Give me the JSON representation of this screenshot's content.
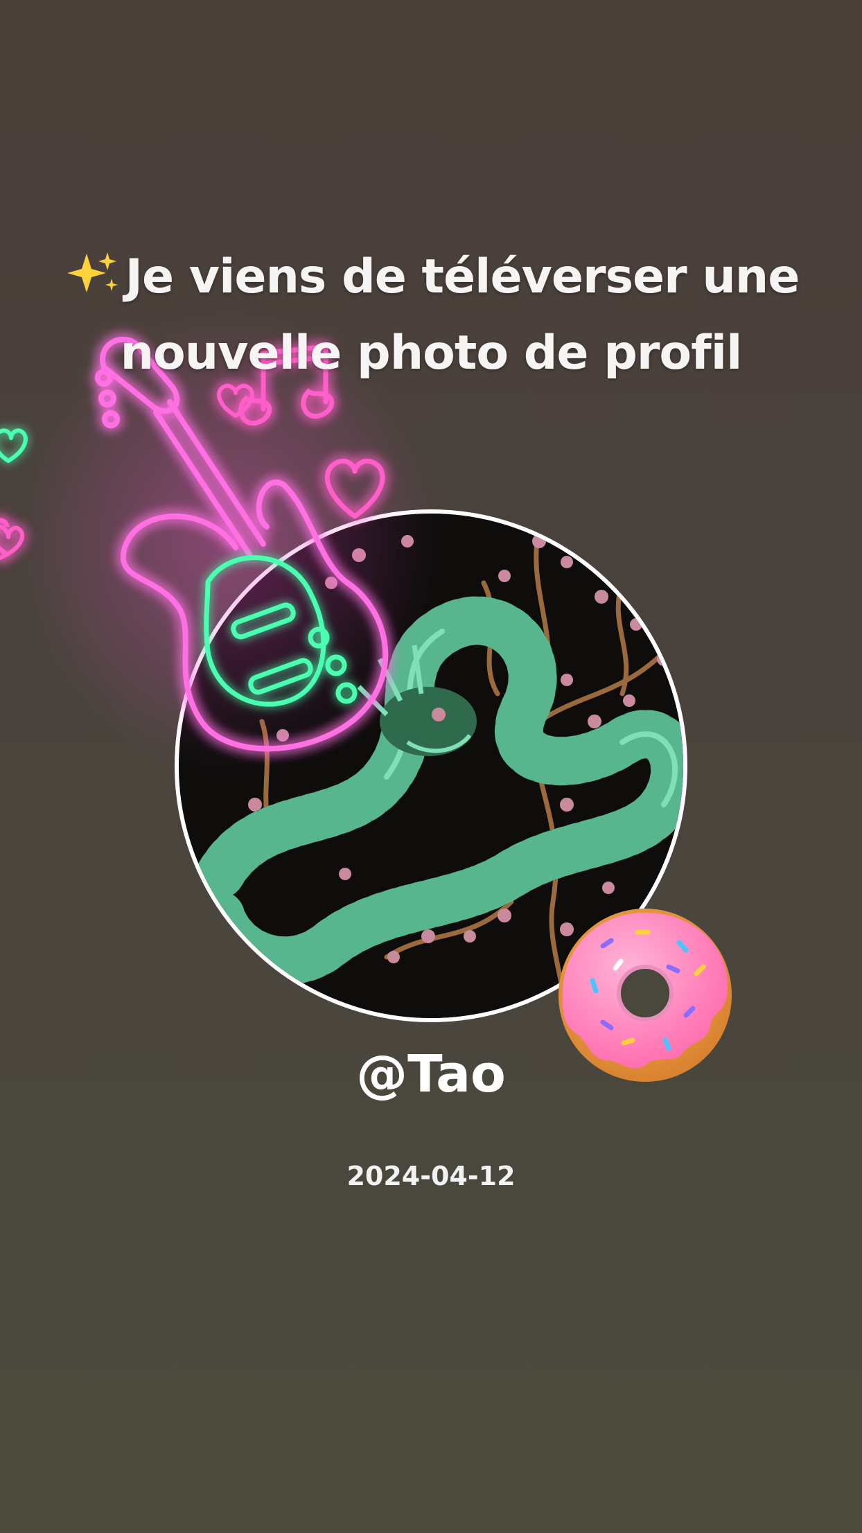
{
  "post": {
    "title": "Je viens de téléverser une nouvelle photo de profil",
    "sparkle_icon": "sparkles-icon",
    "username": "@Tao",
    "date": "2024-04-12"
  },
  "stickers": {
    "guitar": "neon-guitar-icon",
    "notes": "neon-music-notes-icon",
    "hearts": "neon-heart-icon",
    "donut": "donut-icon"
  },
  "colors": {
    "background_top": "#4b3f3a",
    "background_bottom": "#4a4b3d",
    "text": "#f7f4f4",
    "neon_pink": "#ff4fd8",
    "neon_green": "#4cffb0",
    "avatar_border": "#ffffff"
  }
}
